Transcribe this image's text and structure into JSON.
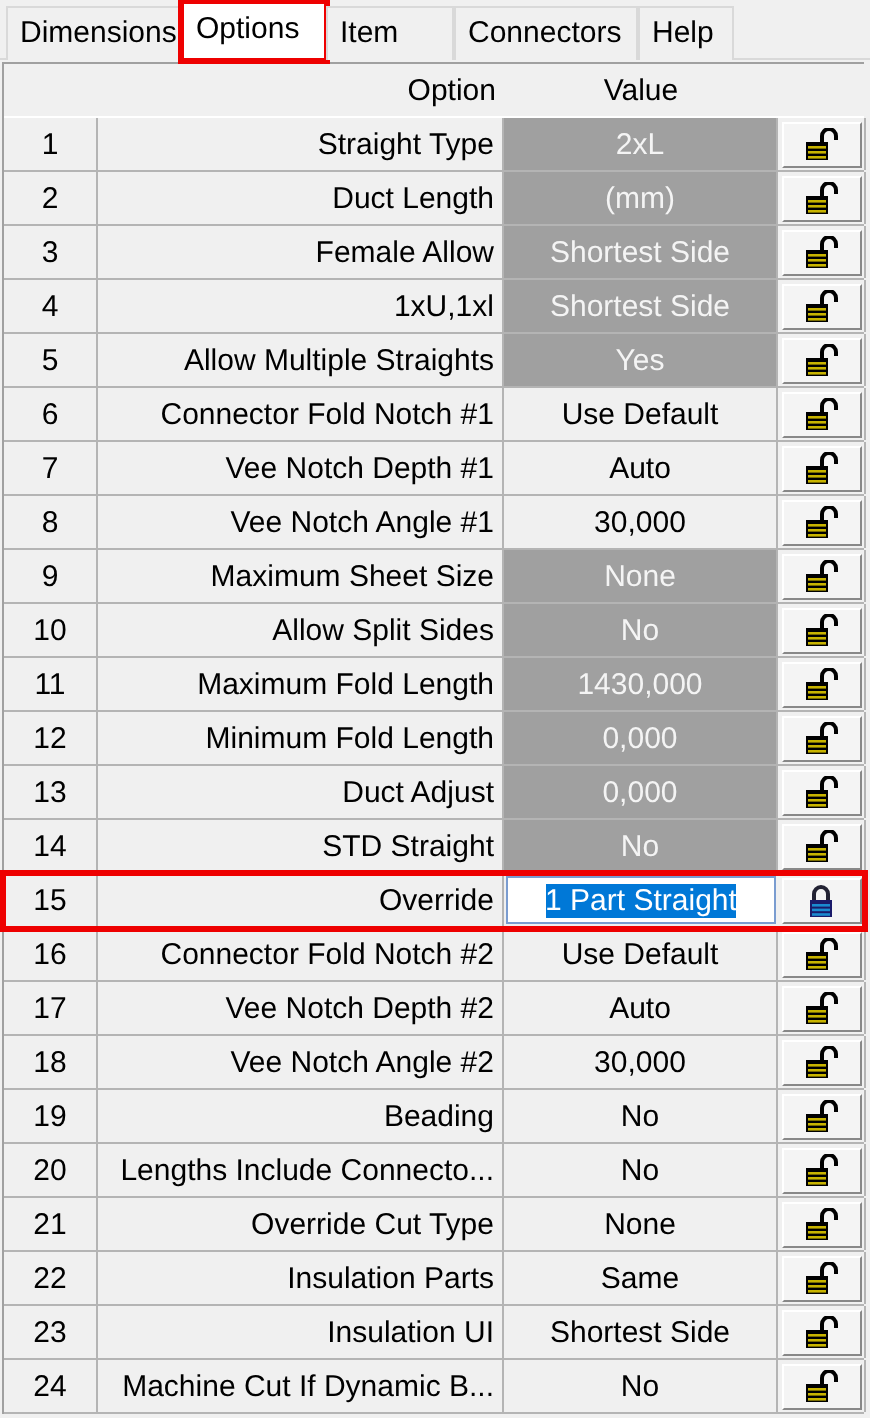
{
  "tabs": [
    {
      "label": "Dimensions",
      "selected": false,
      "highlighted": false
    },
    {
      "label": "Options",
      "selected": true,
      "highlighted": true
    },
    {
      "label": "Item",
      "selected": false,
      "highlighted": false
    },
    {
      "label": "Connectors",
      "selected": false,
      "highlighted": false
    },
    {
      "label": "Help",
      "selected": false,
      "highlighted": false
    }
  ],
  "table": {
    "columns": [
      "Option",
      "Value"
    ],
    "rows": [
      {
        "number": "1",
        "option": "Straight Type",
        "value": "2xL",
        "greyed": true,
        "locked": false,
        "editing": false,
        "highlighted": false
      },
      {
        "number": "2",
        "option": "Duct Length",
        "value": "(mm)",
        "greyed": true,
        "locked": false,
        "editing": false,
        "highlighted": false
      },
      {
        "number": "3",
        "option": "Female Allow",
        "value": "Shortest Side",
        "greyed": true,
        "locked": false,
        "editing": false,
        "highlighted": false
      },
      {
        "number": "4",
        "option": "1xU,1xl",
        "value": "Shortest Side",
        "greyed": true,
        "locked": false,
        "editing": false,
        "highlighted": false
      },
      {
        "number": "5",
        "option": "Allow Multiple Straights",
        "value": "Yes",
        "greyed": true,
        "locked": false,
        "editing": false,
        "highlighted": false
      },
      {
        "number": "6",
        "option": "Connector Fold Notch #1",
        "value": "Use Default",
        "greyed": false,
        "locked": false,
        "editing": false,
        "highlighted": false
      },
      {
        "number": "7",
        "option": "Vee Notch Depth #1",
        "value": "Auto",
        "greyed": false,
        "locked": false,
        "editing": false,
        "highlighted": false
      },
      {
        "number": "8",
        "option": "Vee Notch Angle #1",
        "value": "30,000",
        "greyed": false,
        "locked": false,
        "editing": false,
        "highlighted": false
      },
      {
        "number": "9",
        "option": "Maximum Sheet Size",
        "value": "None",
        "greyed": true,
        "locked": false,
        "editing": false,
        "highlighted": false
      },
      {
        "number": "10",
        "option": "Allow Split Sides",
        "value": "No",
        "greyed": true,
        "locked": false,
        "editing": false,
        "highlighted": false
      },
      {
        "number": "11",
        "option": "Maximum Fold Length",
        "value": "1430,000",
        "greyed": true,
        "locked": false,
        "editing": false,
        "highlighted": false
      },
      {
        "number": "12",
        "option": "Minimum Fold Length",
        "value": "0,000",
        "greyed": true,
        "locked": false,
        "editing": false,
        "highlighted": false
      },
      {
        "number": "13",
        "option": "Duct Adjust",
        "value": "0,000",
        "greyed": true,
        "locked": false,
        "editing": false,
        "highlighted": false
      },
      {
        "number": "14",
        "option": "STD Straight",
        "value": "No",
        "greyed": true,
        "locked": false,
        "editing": false,
        "highlighted": false
      },
      {
        "number": "15",
        "option": "Override",
        "value": "1 Part Straight",
        "greyed": false,
        "locked": true,
        "editing": true,
        "highlighted": true
      },
      {
        "number": "16",
        "option": "Connector Fold Notch #2",
        "value": "Use Default",
        "greyed": false,
        "locked": false,
        "editing": false,
        "highlighted": false
      },
      {
        "number": "17",
        "option": "Vee Notch Depth #2",
        "value": "Auto",
        "greyed": false,
        "locked": false,
        "editing": false,
        "highlighted": false
      },
      {
        "number": "18",
        "option": "Vee Notch Angle #2",
        "value": "30,000",
        "greyed": false,
        "locked": false,
        "editing": false,
        "highlighted": false
      },
      {
        "number": "19",
        "option": "Beading",
        "value": "No",
        "greyed": false,
        "locked": false,
        "editing": false,
        "highlighted": false
      },
      {
        "number": "20",
        "option": "Lengths Include Connecto...",
        "value": "No",
        "greyed": false,
        "locked": false,
        "editing": false,
        "highlighted": false
      },
      {
        "number": "21",
        "option": "Override Cut Type",
        "value": "None",
        "greyed": false,
        "locked": false,
        "editing": false,
        "highlighted": false
      },
      {
        "number": "22",
        "option": "Insulation Parts",
        "value": "Same",
        "greyed": false,
        "locked": false,
        "editing": false,
        "highlighted": false
      },
      {
        "number": "23",
        "option": "Insulation UI",
        "value": "Shortest Side",
        "greyed": false,
        "locked": false,
        "editing": false,
        "highlighted": false
      },
      {
        "number": "24",
        "option": "Machine Cut If Dynamic B...",
        "value": "No",
        "greyed": false,
        "locked": false,
        "editing": false,
        "highlighted": false
      }
    ]
  }
}
